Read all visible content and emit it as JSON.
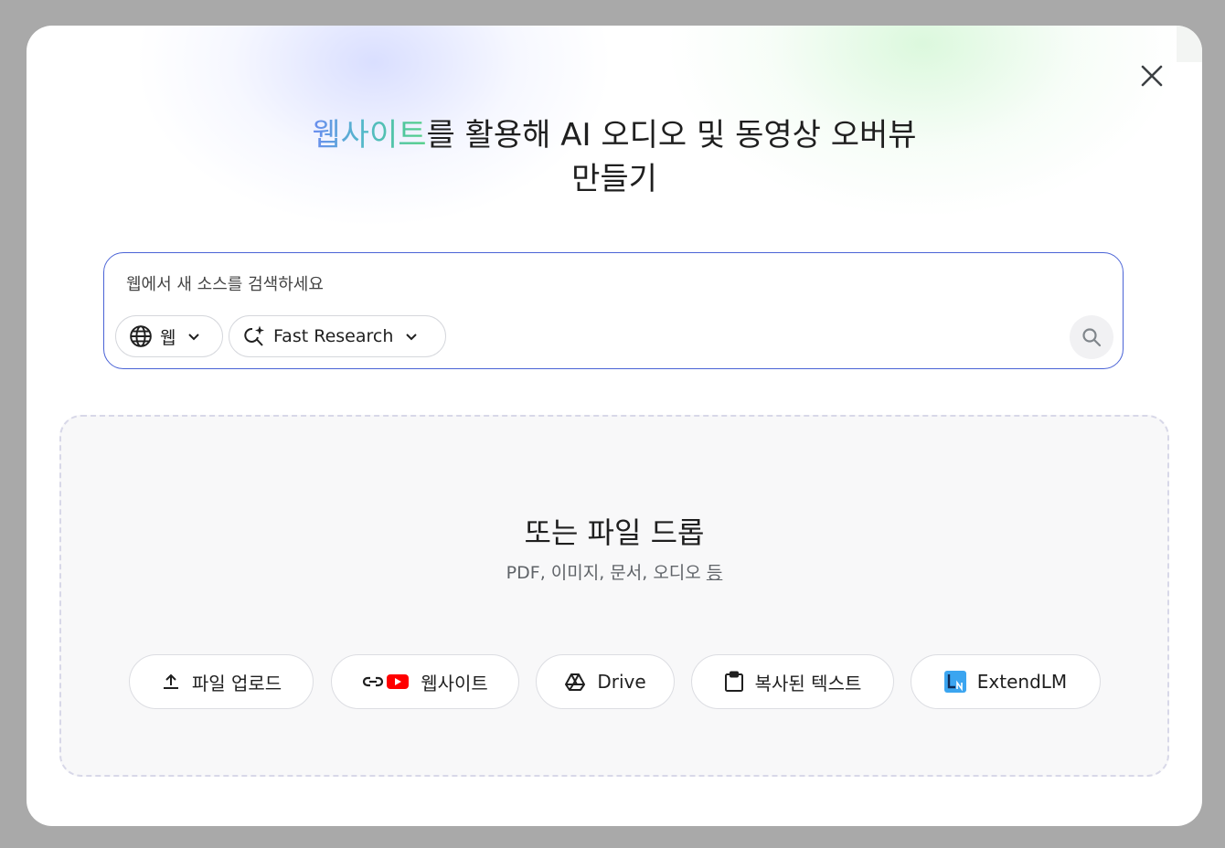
{
  "dialog": {
    "headline": {
      "highlight": "웹사이트",
      "rest_line1": "를 활용해 AI 오디오 및 동영상 오버뷰",
      "line2": "만들기"
    },
    "close_icon": "close-icon"
  },
  "search": {
    "placeholder": "웹에서 새 소스를 검색하세요",
    "source_chip": {
      "label": "웹",
      "icon": "globe-icon"
    },
    "mode_chip": {
      "label": "Fast Research",
      "icon": "sparkle-search-icon"
    },
    "submit_icon": "search-icon"
  },
  "dropzone": {
    "title": "또는 파일 드롭",
    "subtitle_main": "PDF, 이미지, 문서, 오디오",
    "subtitle_link": "등",
    "buttons": [
      {
        "label": "파일 업로드",
        "icon": "upload-icon"
      },
      {
        "label": "웹사이트",
        "icon": "link-icon"
      },
      {
        "label": "Drive",
        "icon": "drive-icon"
      },
      {
        "label": "복사된 텍스트",
        "icon": "clipboard-icon"
      },
      {
        "label": "ExtendLM",
        "icon": "extendlm-icon"
      }
    ]
  },
  "colors": {
    "accent_border": "#4a63d6",
    "gradient_start": "#6b8cf0",
    "gradient_end": "#4fcf83",
    "youtube_red": "#ff0000"
  }
}
